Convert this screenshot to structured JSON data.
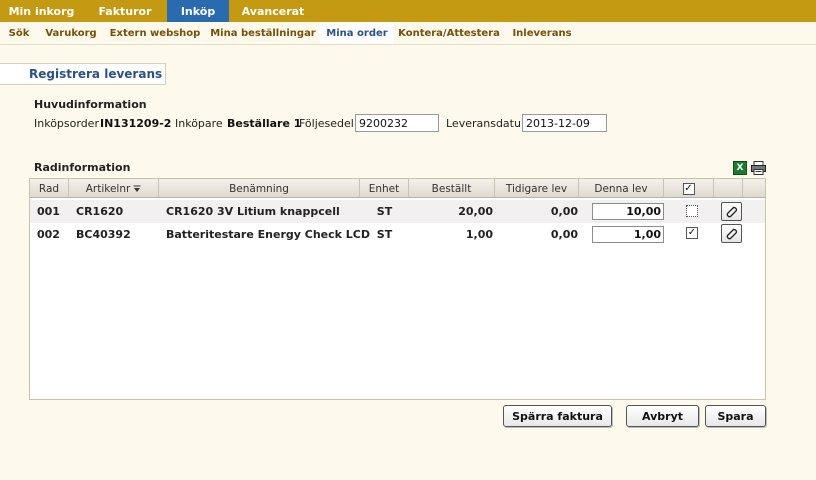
{
  "topnav": {
    "tabs": [
      {
        "label": "Min inkorg"
      },
      {
        "label": "Fakturor"
      },
      {
        "label": "Inköp",
        "active": true
      },
      {
        "label": "Avancerat"
      }
    ]
  },
  "subnav": {
    "items": [
      {
        "label": "Sök"
      },
      {
        "label": "Varukorg"
      },
      {
        "label": "Extern webshop"
      },
      {
        "label": "Mina beställningar"
      },
      {
        "label": "Mina order",
        "active": true
      },
      {
        "label": "Kontera/Attestera"
      },
      {
        "label": "Inleverans"
      }
    ]
  },
  "page": {
    "title": "Registrera leverans"
  },
  "main_info": {
    "heading": "Huvudinformation",
    "order_label": "Inköpsorder",
    "order_value": "IN131209-2",
    "buyer_label": "Inköpare",
    "buyer_value": "Beställare 1",
    "slip_label": "Följesedel",
    "slip_value": "9200232",
    "date_label": "Leveransdatum",
    "date_value": "2013-12-09"
  },
  "rows_section": {
    "heading": "Radinformation",
    "export_icon": "excel-icon",
    "print_icon": "printer-icon"
  },
  "grid": {
    "columns": [
      "Rad",
      "Artikelnr",
      "Benämning",
      "Enhet",
      "Beställt",
      "Tidigare lev",
      "Denna lev"
    ],
    "select_all_checked": true,
    "rows": [
      {
        "rad": "001",
        "artikelnr": "CR1620",
        "benamning": "CR1620 3V Litium knappcell",
        "enhet": "ST",
        "bestallt": "20,00",
        "tidigare": "0,00",
        "denna": "10,00",
        "checked": false
      },
      {
        "rad": "002",
        "artikelnr": "BC40392",
        "benamning": "Batteritestare Energy Check LCD",
        "enhet": "ST",
        "bestallt": "1,00",
        "tidigare": "0,00",
        "denna": "1,00",
        "checked": true
      }
    ]
  },
  "actions": {
    "block_invoice": "Spärra faktura",
    "cancel": "Avbryt",
    "save": "Spara"
  },
  "colors": {
    "nav_bar": "#c49a12",
    "active_tab": "#2a6bb0",
    "page_bg": "#fdf9ec",
    "title_text": "#2a5288"
  }
}
